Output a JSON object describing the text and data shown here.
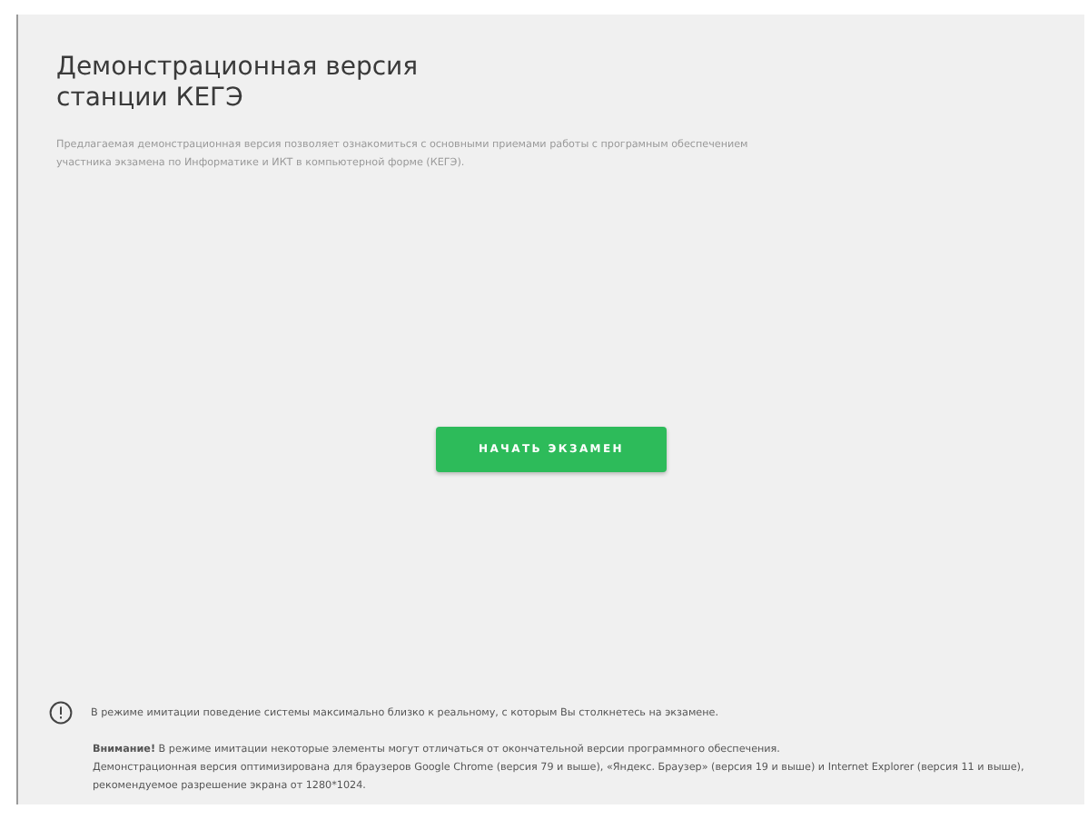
{
  "header": {
    "title": "Демонстрационная версия станции КЕГЭ",
    "description": "Предлагаемая демонстрационная версия позволяет ознакомиться с основными приемами работы с програмным обеспечением участника экзамена по Информатике и ИКТ в компьютерной форме (КЕГЭ)."
  },
  "start_button": {
    "label": "НАЧАТЬ ЭКЗАМЕН"
  },
  "footer": {
    "notice": "В режиме имитации поведение системы максимально близко к реальному, с которым Вы столкнетесь на экзамене.",
    "warning": "**Внимание!** В режиме имитации некоторые элементы могут отличаться от окончательной версии программного обеспечения.",
    "browsers": "Демонстрационная версия оптимизирована для браузеров Google Chrome (версия 79 и выше), «Яндекс. Браузер» (версия 19 и выше) и Internet Explorer (версия 11 и выше), рекомендуемое разрешение экрана от 1280*1024."
  }
}
